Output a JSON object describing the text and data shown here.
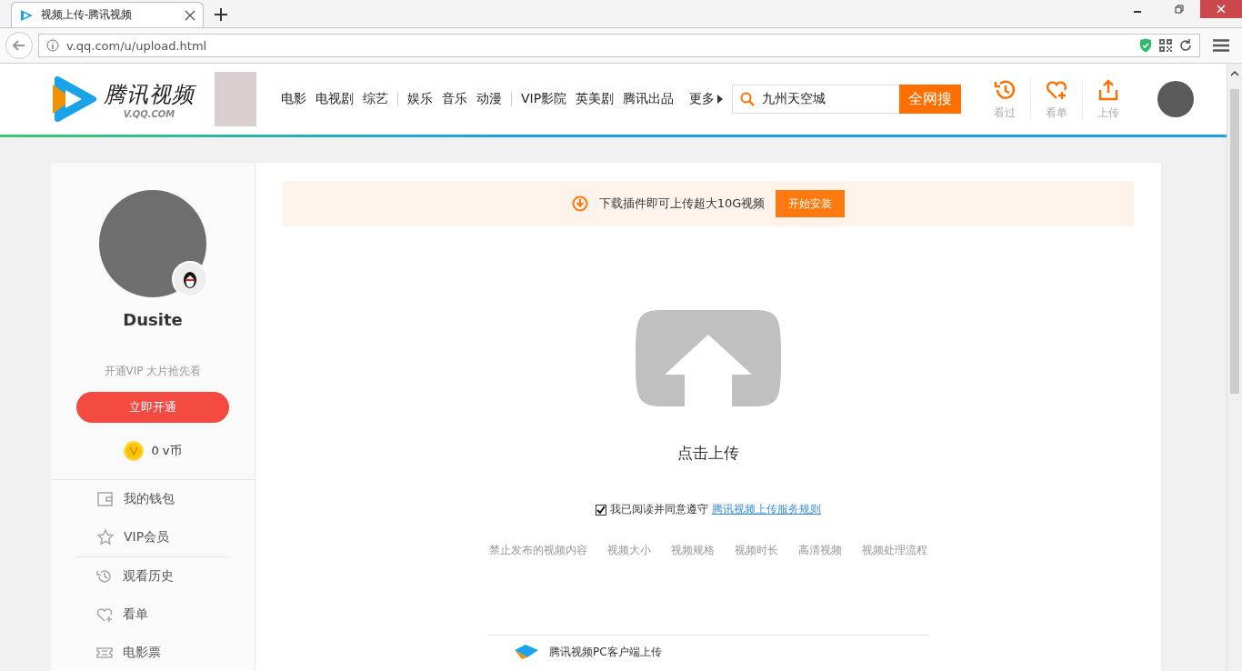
{
  "browser": {
    "tab_title": "视频上传-腾讯视频",
    "url": "v.qq.com/u/upload.html"
  },
  "header": {
    "logo_text": "腾讯视频",
    "logo_sub": "V.QQ.COM",
    "nav_groups": [
      [
        "电影",
        "电视剧",
        "综艺"
      ],
      [
        "娱乐",
        "音乐",
        "动漫"
      ],
      [
        "VIP影院",
        "英美剧",
        "腾讯出品"
      ]
    ],
    "more": "更多",
    "search": {
      "value": "九州天空城",
      "button": "全网搜"
    },
    "actions": [
      "看过",
      "看单",
      "上传"
    ]
  },
  "sidebar": {
    "username": "Dusite",
    "vip_tip": "开通VIP 大片抢先看",
    "vip_button": "立即开通",
    "coins": "0 v币",
    "menu_groups": [
      [
        "我的钱包",
        "VIP会员"
      ],
      [
        "观看历史",
        "看单",
        "电影票"
      ]
    ]
  },
  "main": {
    "banner": {
      "text": "下载插件即可上传超大10G视频",
      "button": "开始安装"
    },
    "upload_label": "点击上传",
    "agreement": {
      "checked": true,
      "text": "我已阅读并同意遵守",
      "link": "腾讯视频上传服务规则"
    },
    "help_links": [
      "禁止发布的视频内容",
      "视频大小",
      "视频规格",
      "视频时长",
      "高清视频",
      "视频处理流程"
    ],
    "client_upload": "腾讯视频PC客户端上传"
  }
}
